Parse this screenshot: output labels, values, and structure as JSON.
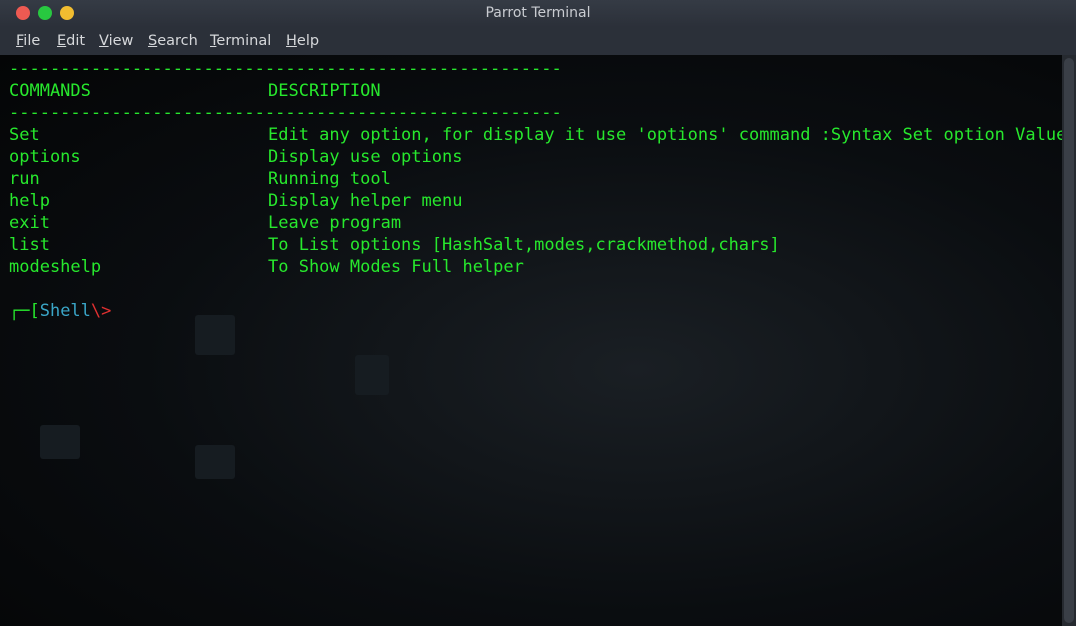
{
  "window": {
    "title": "Parrot Terminal"
  },
  "menubar": {
    "items": [
      {
        "label_first": "F",
        "label_rest": "ile"
      },
      {
        "label_first": "E",
        "label_rest": "dit"
      },
      {
        "label_first": "V",
        "label_rest": "iew"
      },
      {
        "label_first": "S",
        "label_rest": "earch"
      },
      {
        "label_first": "T",
        "label_rest": "erminal"
      },
      {
        "label_first": "H",
        "label_rest": "elp"
      }
    ]
  },
  "terminal": {
    "separator": "------------------------------------------------------",
    "header": {
      "commands": "COMMANDS",
      "description": "DESCRIPTION"
    },
    "rows": [
      {
        "command": "Set",
        "description": "Edit any option, for display it use 'options' command :Syntax Set option Value"
      },
      {
        "command": "options",
        "description": "Display use options"
      },
      {
        "command": "run",
        "description": "Running tool"
      },
      {
        "command": "help",
        "description": "Display helper menu"
      },
      {
        "command": "exit",
        "description": "Leave program"
      },
      {
        "command": "list",
        "description": "To List options [HashSalt,modes,crackmethod,chars]"
      },
      {
        "command": "modeshelp",
        "description": "To Show Modes Full helper"
      }
    ],
    "prompt": {
      "bracket": "┌─[",
      "shell": "Shell",
      "symbol": "\\>"
    }
  },
  "colors": {
    "text_green": "#27e82d",
    "prompt_blue": "#3aa6c8",
    "prompt_red": "#e03030",
    "titlebar": "#2e3440"
  }
}
